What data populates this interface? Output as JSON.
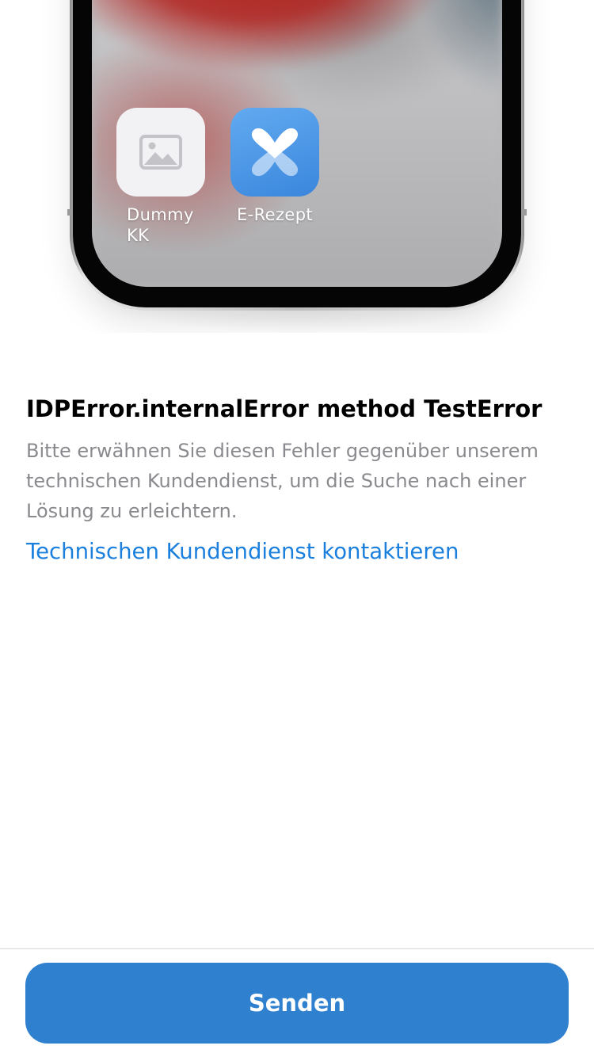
{
  "illustration": {
    "apps": [
      {
        "label": "Dummy KK",
        "icon": "image-placeholder-icon"
      },
      {
        "label": "E-Rezept",
        "icon": "e-rezept-heart-icon"
      }
    ]
  },
  "error": {
    "title": "IDPError.internalError method TestError",
    "description": "Bitte erwähnen Sie diesen Fehler gegenüber unserem technischen Kundendienst, um die Suche nach einer Lösung zu erleichtern.",
    "contact_link": "Technischen Kundendienst kontaktieren"
  },
  "footer": {
    "send_label": "Senden"
  },
  "colors": {
    "link": "#1a7fdd",
    "primary_button": "#2f80cf",
    "description_text": "#8a8a8e",
    "title_text": "#000000"
  }
}
